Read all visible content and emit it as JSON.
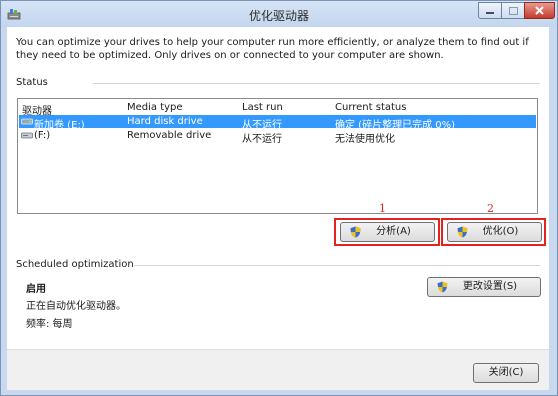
{
  "window": {
    "title": "优化驱动器"
  },
  "description": "You can optimize your drives to help your computer run more efficiently, or analyze them to find out if they need to be optimized. Only drives on or connected to your computer are shown.",
  "status": {
    "section_label": "Status",
    "columns": [
      "驱动器",
      "Media type",
      "Last run",
      "Current status"
    ],
    "rows": [
      {
        "drive": "新加卷 (E:)",
        "media_type": "Hard disk drive",
        "last_run": "从不运行",
        "current_status": "确定 (碎片整理已完成 0%)",
        "selected": true
      },
      {
        "drive": "(F:)",
        "media_type": "Removable drive",
        "last_run": "从不运行",
        "current_status": "无法使用优化",
        "selected": false
      }
    ]
  },
  "buttons": {
    "analyze": "分析(A)",
    "optimize": "优化(O)",
    "change_settings": "更改设置(S)",
    "close": "关闭(C)"
  },
  "markers": {
    "analyze": "1",
    "optimize": "2"
  },
  "scheduled": {
    "section_label": "Scheduled optimization",
    "state": "启用",
    "detail": "正在自动优化驱动器。",
    "frequency": "频率: 每周"
  },
  "colors": {
    "selection": "#3399ff",
    "highlight_box": "#e32322",
    "frame": "#c8d9ef"
  }
}
